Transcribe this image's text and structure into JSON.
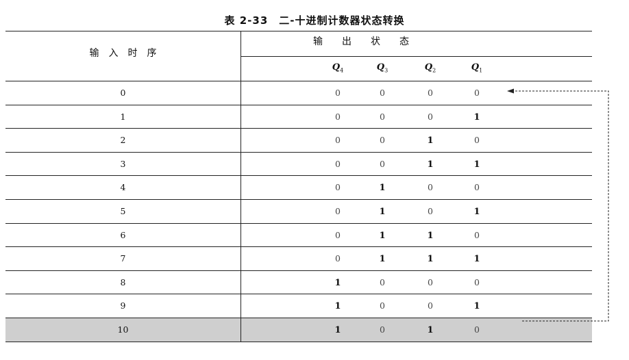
{
  "title": "表 2-33　二-十进制计数器状态转换",
  "header": {
    "input_label": "输　入　时　序",
    "output_label": "输　　出　　状　　态",
    "q_columns": [
      {
        "letter": "Q",
        "sub": "4"
      },
      {
        "letter": "Q",
        "sub": "3"
      },
      {
        "letter": "Q",
        "sub": "2"
      },
      {
        "letter": "Q",
        "sub": "1"
      }
    ]
  },
  "rows": [
    {
      "step": "0",
      "q": [
        "0",
        "0",
        "0",
        "0"
      ]
    },
    {
      "step": "1",
      "q": [
        "0",
        "0",
        "0",
        "1"
      ]
    },
    {
      "step": "2",
      "q": [
        "0",
        "0",
        "1",
        "0"
      ]
    },
    {
      "step": "3",
      "q": [
        "0",
        "0",
        "1",
        "1"
      ]
    },
    {
      "step": "4",
      "q": [
        "0",
        "1",
        "0",
        "0"
      ]
    },
    {
      "step": "5",
      "q": [
        "0",
        "1",
        "0",
        "1"
      ]
    },
    {
      "step": "6",
      "q": [
        "0",
        "1",
        "1",
        "0"
      ]
    },
    {
      "step": "7",
      "q": [
        "0",
        "1",
        "1",
        "1"
      ]
    },
    {
      "step": "8",
      "q": [
        "1",
        "0",
        "0",
        "0"
      ]
    },
    {
      "step": "9",
      "q": [
        "1",
        "0",
        "0",
        "1"
      ]
    },
    {
      "step": "10",
      "q": [
        "1",
        "0",
        "1",
        "0"
      ],
      "highlight": true
    }
  ],
  "colors": {
    "highlight_row": "#cfcfcf",
    "rule": "#222222"
  }
}
